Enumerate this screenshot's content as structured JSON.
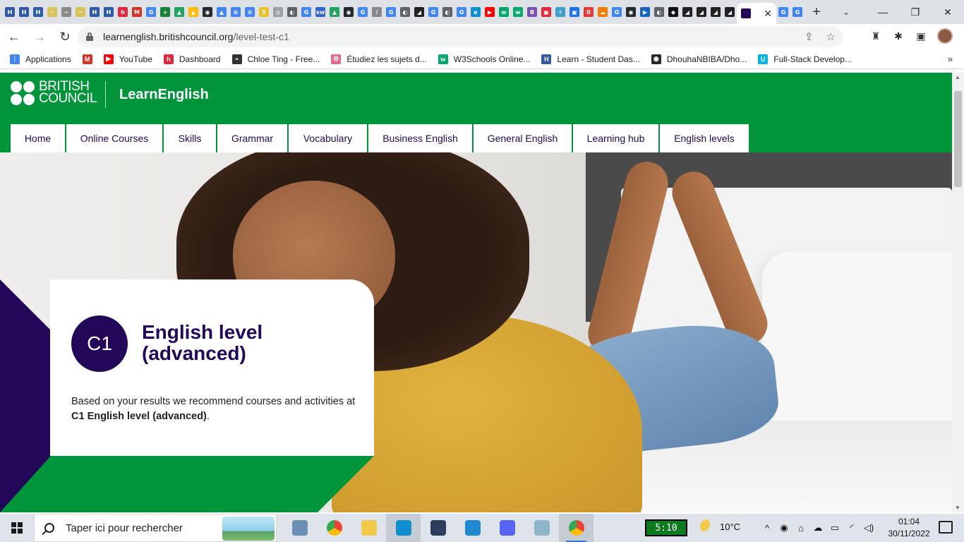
{
  "browser": {
    "tab_favicons": [
      {
        "icon": "codehs-icon",
        "color": "#2f5aa8",
        "glyph": "H"
      },
      {
        "icon": "codehs-icon",
        "color": "#2f5aa8",
        "glyph": "H"
      },
      {
        "icon": "codehs-icon",
        "color": "#2f5aa8",
        "glyph": "H"
      },
      {
        "icon": "yellow-icon",
        "color": "#d8c35a",
        "glyph": "~"
      },
      {
        "icon": "grey-icon",
        "color": "#8a8a8a",
        "glyph": "~"
      },
      {
        "icon": "yellow-icon",
        "color": "#d8c35a",
        "glyph": "~"
      },
      {
        "icon": "codehs-icon",
        "color": "#2f5aa8",
        "glyph": "H"
      },
      {
        "icon": "codehs-icon",
        "color": "#2f5aa8",
        "glyph": "H"
      },
      {
        "icon": "holberton-icon",
        "color": "#e0283f",
        "glyph": "h"
      },
      {
        "icon": "gmail-icon",
        "color": "#d93025",
        "glyph": "M"
      },
      {
        "icon": "google-icon",
        "color": "#4285f4",
        "glyph": "G"
      },
      {
        "icon": "sheets-icon",
        "color": "#188038",
        "glyph": "+"
      },
      {
        "icon": "drive-icon",
        "color": "#1fa463",
        "glyph": "▲"
      },
      {
        "icon": "drive-icon",
        "color": "#fbbc04",
        "glyph": "▲"
      },
      {
        "icon": "github-icon",
        "color": "#24292e",
        "glyph": "◉"
      },
      {
        "icon": "drive-icon",
        "color": "#4285f4",
        "glyph": "▲"
      },
      {
        "icon": "docs-icon",
        "color": "#4285f4",
        "glyph": "≡"
      },
      {
        "icon": "docs-icon",
        "color": "#4285f4",
        "glyph": "≡"
      },
      {
        "icon": "number-icon",
        "color": "#e8c22b",
        "glyph": "5"
      },
      {
        "icon": "generic-icon",
        "color": "#9aa0a6",
        "glyph": "◎"
      },
      {
        "icon": "web-icon",
        "color": "#5f6368",
        "glyph": "◐"
      },
      {
        "icon": "google-icon",
        "color": "#4285f4",
        "glyph": "G"
      },
      {
        "icon": "xw-icon",
        "color": "#3366cc",
        "glyph": "xw"
      },
      {
        "icon": "drive-icon",
        "color": "#1fa463",
        "glyph": "▲"
      },
      {
        "icon": "github-icon",
        "color": "#24292e",
        "glyph": "◉"
      },
      {
        "icon": "google-icon",
        "color": "#4285f4",
        "glyph": "G"
      },
      {
        "icon": "web-icon",
        "color": "#888888",
        "glyph": "/"
      },
      {
        "icon": "google-icon",
        "color": "#4285f4",
        "glyph": "G"
      },
      {
        "icon": "web-icon",
        "color": "#5f6368",
        "glyph": "◐"
      },
      {
        "icon": "chart-icon",
        "color": "#222222",
        "glyph": "◢"
      },
      {
        "icon": "google-icon",
        "color": "#4285f4",
        "glyph": "G"
      },
      {
        "icon": "web-icon",
        "color": "#5f6368",
        "glyph": "◐"
      },
      {
        "icon": "google-icon",
        "color": "#4285f4",
        "glyph": "G"
      },
      {
        "icon": "edge-icon",
        "color": "#0f8fd0",
        "glyph": "e"
      },
      {
        "icon": "youtube-icon",
        "color": "#ff0000",
        "glyph": "▶"
      },
      {
        "icon": "w3schools-icon",
        "color": "#04aa6d",
        "glyph": "w"
      },
      {
        "icon": "w3schools-icon",
        "color": "#04aa6d",
        "glyph": "w"
      },
      {
        "icon": "b-icon",
        "color": "#7952b3",
        "glyph": "B"
      },
      {
        "icon": "app-icon",
        "color": "#e0283f",
        "glyph": "▣"
      },
      {
        "icon": "react-icon",
        "color": "#3aa0c8",
        "glyph": "⚛"
      },
      {
        "icon": "app-icon",
        "color": "#1a73e8",
        "glyph": "▣"
      },
      {
        "icon": "red-icon",
        "color": "#e53935",
        "glyph": "0"
      },
      {
        "icon": "cloud-icon",
        "color": "#f57c00",
        "glyph": "☁"
      },
      {
        "icon": "google-icon",
        "color": "#4285f4",
        "glyph": "G"
      },
      {
        "icon": "github-icon",
        "color": "#24292e",
        "glyph": "◉"
      },
      {
        "icon": "play-icon",
        "color": "#1565c0",
        "glyph": "▶"
      },
      {
        "icon": "web-icon",
        "color": "#5f6368",
        "glyph": "◐"
      },
      {
        "icon": "app-icon",
        "color": "#111111",
        "glyph": "◆"
      },
      {
        "icon": "chart-icon",
        "color": "#222222",
        "glyph": "◢"
      },
      {
        "icon": "chart-icon",
        "color": "#222222",
        "glyph": "◢"
      },
      {
        "icon": "chart-icon",
        "color": "#222222",
        "glyph": "◢"
      },
      {
        "icon": "chart-icon",
        "color": "#222222",
        "glyph": "◢"
      }
    ],
    "active_tab": {
      "icon": "british-council-icon",
      "color": "#23085a",
      "close_glyph": "✕"
    },
    "trailing_tabs": [
      {
        "icon": "google-icon",
        "color": "#4285f4",
        "glyph": "G"
      },
      {
        "icon": "google-icon",
        "color": "#4285f4",
        "glyph": "G"
      }
    ],
    "new_tab_glyph": "+",
    "tab_search_glyph": "⌄",
    "window_controls": {
      "minimize": "—",
      "restore": "❐",
      "close": "✕"
    },
    "nav": {
      "back": "←",
      "forward": "→",
      "reload": "↻"
    },
    "url_host": "learnenglish.britishcouncil.org",
    "url_path": "/level-test-c1",
    "omnibox_icons": {
      "share": "⇪",
      "star": "☆"
    },
    "extension_icons": {
      "ext1": "♜",
      "puzzle": "✱",
      "sidebar": "▣"
    },
    "bookmarks": [
      {
        "label": "Applications",
        "icon": "apps-grid-icon",
        "color": "#4285f4",
        "glyph": "⋮"
      },
      {
        "label": "",
        "icon": "gmail-icon",
        "color": "#d93025",
        "glyph": "M"
      },
      {
        "label": "YouTube",
        "icon": "youtube-icon",
        "color": "#ff0000",
        "glyph": "▶"
      },
      {
        "label": "Dashboard",
        "icon": "holberton-icon",
        "color": "#e0283f",
        "glyph": "h"
      },
      {
        "label": "Chloe Ting - Free...",
        "icon": "chloe-icon",
        "color": "#333333",
        "glyph": "◓"
      },
      {
        "label": "Étudiez les sujets d...",
        "icon": "khan-icon",
        "color": "#e46b8e",
        "glyph": "✿"
      },
      {
        "label": "W3Schools Online...",
        "icon": "w3schools-icon",
        "color": "#04aa6d",
        "glyph": "w"
      },
      {
        "label": "Learn - Student Das...",
        "icon": "codehs-icon",
        "color": "#2f5aa8",
        "glyph": "H"
      },
      {
        "label": "DhouhaNBIBA/Dho...",
        "icon": "github-icon",
        "color": "#24292e",
        "glyph": "◉"
      },
      {
        "label": "Full-Stack Develop...",
        "icon": "udacity-icon",
        "color": "#02b3e4",
        "glyph": "U"
      }
    ],
    "bookmarks_more": "»"
  },
  "site": {
    "brand_line1": "BRITISH",
    "brand_line2": "COUNCIL",
    "section_title": "LearnEnglish",
    "nav": [
      {
        "label": "Home",
        "w": 77
      },
      {
        "label": "Online Courses",
        "w": 136
      },
      {
        "label": "Skills",
        "w": 74
      },
      {
        "label": "Grammar",
        "w": 99
      },
      {
        "label": "Vocabulary",
        "w": 111
      },
      {
        "label": "Business English",
        "w": 147
      },
      {
        "label": "General English",
        "w": 139
      },
      {
        "label": "Learning hub",
        "w": 121
      },
      {
        "label": "English levels",
        "w": 126
      }
    ],
    "colors": {
      "green": "#00953b",
      "purple": "#23085a"
    }
  },
  "result_card": {
    "level_badge": "C1",
    "title": "English level (advanced)",
    "text_before": "Based on your results we recommend courses and activities at ",
    "text_bold": "C1 English level (advanced)",
    "text_after": "."
  },
  "taskbar": {
    "search_placeholder": "Taper ici pour rechercher",
    "apps": [
      {
        "name": "file-explorer-app",
        "color": "#6b8fb5"
      },
      {
        "name": "chrome-app",
        "color": "#ea4335"
      },
      {
        "name": "folder-app",
        "color": "#f2c94c"
      },
      {
        "name": "edge-app",
        "color": "#0f8fd0"
      },
      {
        "name": "vs-app",
        "color": "#2c3e5c"
      },
      {
        "name": "vscode-app",
        "color": "#1f8ad2"
      },
      {
        "name": "discord-app",
        "color": "#5865f2"
      },
      {
        "name": "notes-app",
        "color": "#8fb6c8"
      },
      {
        "name": "chrome-app",
        "color": "#ea4335"
      }
    ],
    "battery_widget": "5:10",
    "temperature": "10°C",
    "tray_icons": {
      "chevron": "^",
      "discord": "◉",
      "usb": "⌂",
      "cloud": "☁",
      "battery": "▭",
      "wifi": "◜",
      "volume": "◁)"
    },
    "time": "01:04",
    "date": "30/11/2022"
  }
}
